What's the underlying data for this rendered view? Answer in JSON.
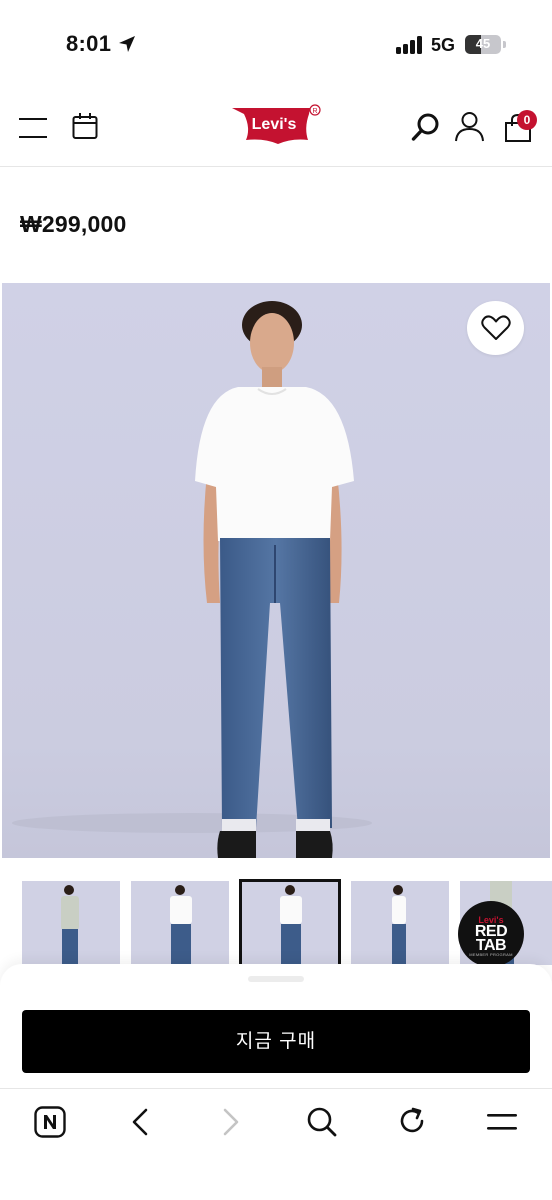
{
  "status_bar": {
    "time": "8:01",
    "network": "5G",
    "battery": "45",
    "battery_level": 0.45
  },
  "header": {
    "brand": "Levi's",
    "menu_icon": "hamburger-menu-icon",
    "calendar_icon": "calendar-icon",
    "search_icon": "search-icon",
    "account_icon": "user-icon",
    "cart_icon": "shopping-bag-icon",
    "cart_count": "0",
    "brand_color": "#c41230"
  },
  "product": {
    "price": "₩299,000",
    "wishlist_icon": "heart-icon",
    "image_background": "#cfd0e4"
  },
  "thumbnails": {
    "count_visible": 5,
    "selected_index": 2
  },
  "red_tab_badge": {
    "brand": "Levi's",
    "title": "RED TAB",
    "subtitle": "MEMBER PROGRAM"
  },
  "purchase": {
    "buy_now_label": "지금 구매"
  },
  "browser_toolbar": {
    "icons": [
      "naver-home-icon",
      "back-arrow-icon",
      "forward-arrow-icon",
      "search-icon",
      "refresh-icon",
      "menu-icon"
    ]
  }
}
